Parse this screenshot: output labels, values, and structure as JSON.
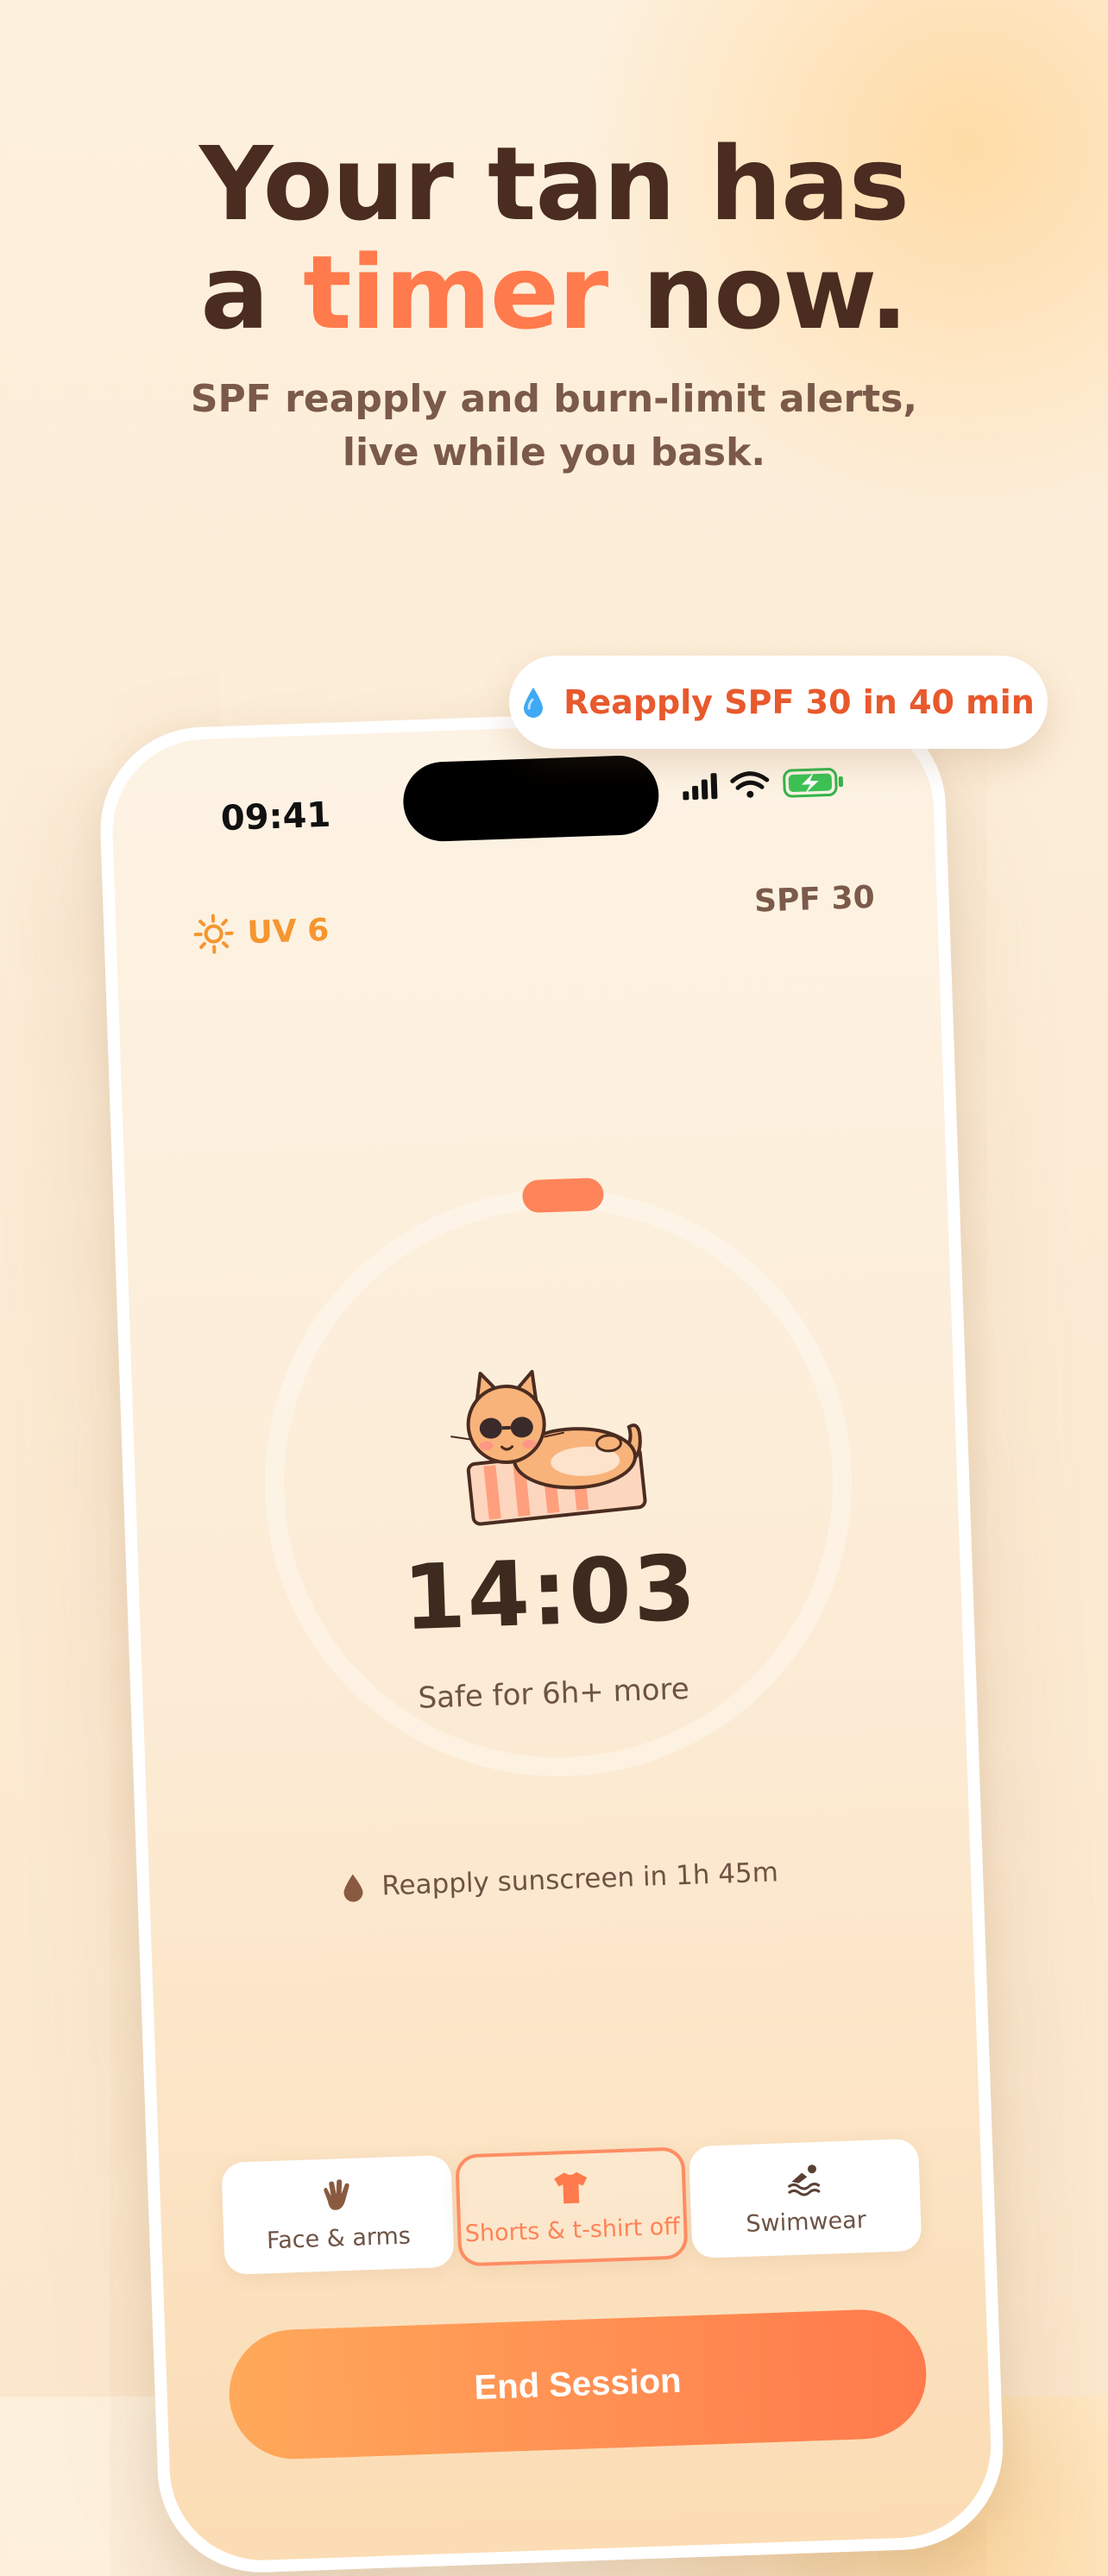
{
  "hero": {
    "title_line1": "Your tan has",
    "title_line2_pre": "a ",
    "title_accent": "timer",
    "title_line2_post": " now.",
    "subtitle_line1": "SPF reapply and burn-limit alerts,",
    "subtitle_line2": "live while you bask."
  },
  "notification": {
    "icon": "water-drop-icon",
    "text": "Reapply SPF 30 in 40 min"
  },
  "status_bar": {
    "time": "09:41",
    "icons": [
      "signal-icon",
      "wifi-icon",
      "battery-charging-icon"
    ]
  },
  "app": {
    "uv_icon": "sun-icon",
    "uv_label": "UV 6",
    "spf_label": "SPF 30",
    "timer": "14:03",
    "safe_text": "Safe for 6h+ more",
    "reapply_icon": "drop-icon",
    "reapply_text": "Reapply sunscreen in 1h 45m",
    "exposure_options": [
      {
        "icon": "hand-wave-icon",
        "label": "Face & arms",
        "selected": false
      },
      {
        "icon": "tshirt-icon",
        "label": "Shorts & t-shirt off",
        "selected": true
      },
      {
        "icon": "swimmer-icon",
        "label": "Swimwear",
        "selected": false
      }
    ],
    "end_button": "End Session"
  },
  "colors": {
    "accent": "#ff7a4c",
    "uv": "#f5962f",
    "text_dark": "#4a2c20",
    "text_muted": "#7b5a4a",
    "notification_text": "#e8592d"
  }
}
